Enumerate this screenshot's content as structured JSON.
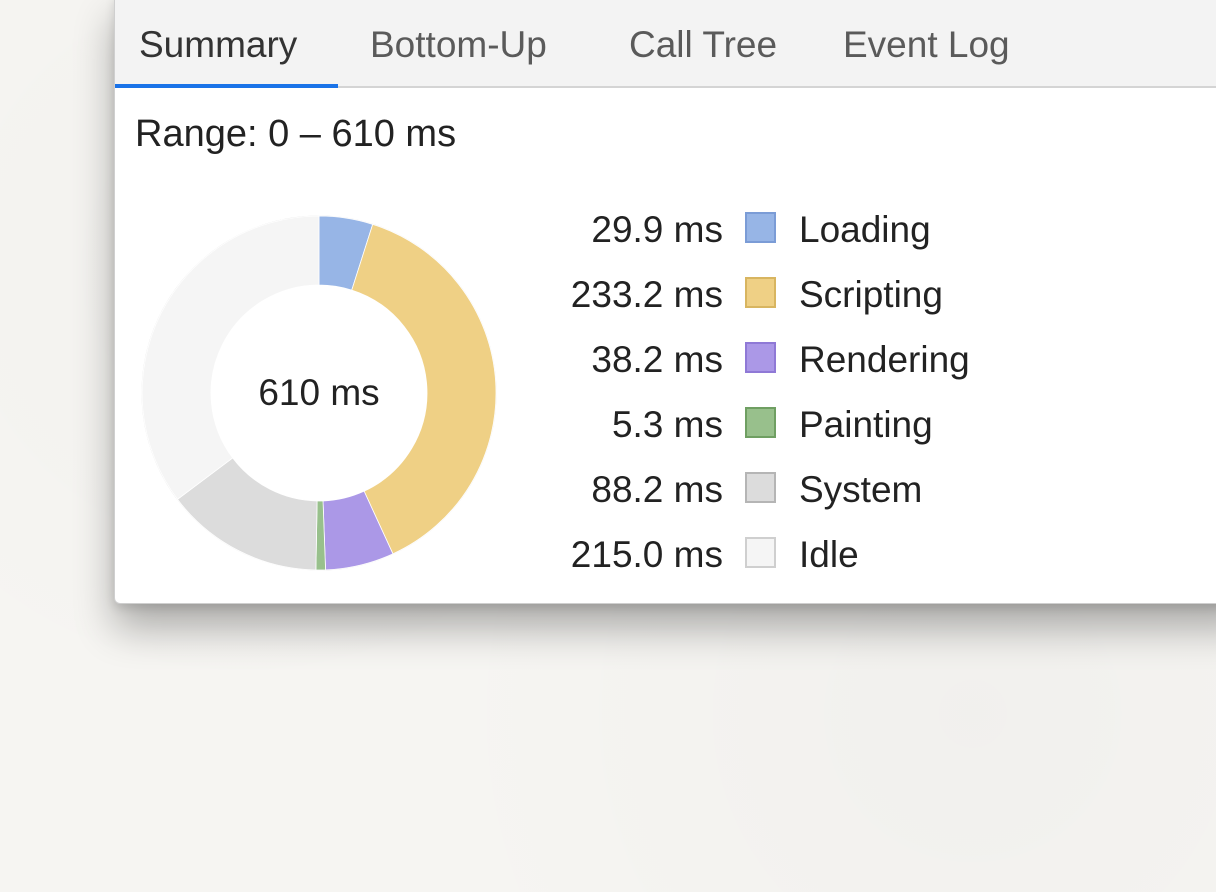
{
  "tabs": [
    {
      "label": "Summary",
      "active": true
    },
    {
      "label": "Bottom-Up",
      "active": false
    },
    {
      "label": "Call Tree",
      "active": false
    },
    {
      "label": "Event Log",
      "active": false
    }
  ],
  "summary": {
    "range_label": "Range: 0 – 610 ms",
    "total_label": "610 ms"
  },
  "colors": {
    "accent": "#1a73e8",
    "loading": "#97b5e6",
    "scripting": "#efd085",
    "rendering": "#ab98e7",
    "painting": "#98c08c",
    "system": "#dcdcdc",
    "idle": "#f5f5f5"
  },
  "chart_data": {
    "type": "pie",
    "title": "",
    "center_label": "610 ms",
    "total": 610,
    "unit": "ms",
    "slices": [
      {
        "label": "Loading",
        "value": 29.9,
        "value_label": "29.9 ms",
        "color": "#97b5e6",
        "border": "#7b9cd6"
      },
      {
        "label": "Scripting",
        "value": 233.2,
        "value_label": "233.2 ms",
        "color": "#efd085",
        "border": "#d8b560"
      },
      {
        "label": "Rendering",
        "value": 38.2,
        "value_label": "38.2 ms",
        "color": "#ab98e7",
        "border": "#8f79d6"
      },
      {
        "label": "Painting",
        "value": 5.3,
        "value_label": "5.3 ms",
        "color": "#98c08c",
        "border": "#6f9f62"
      },
      {
        "label": "System",
        "value": 88.2,
        "value_label": "88.2 ms",
        "color": "#dcdcdc",
        "border": "#b5b5b5"
      },
      {
        "label": "Idle",
        "value": 215.0,
        "value_label": "215.0 ms",
        "color": "#f5f5f5",
        "border": "#cfcfcf"
      }
    ]
  }
}
